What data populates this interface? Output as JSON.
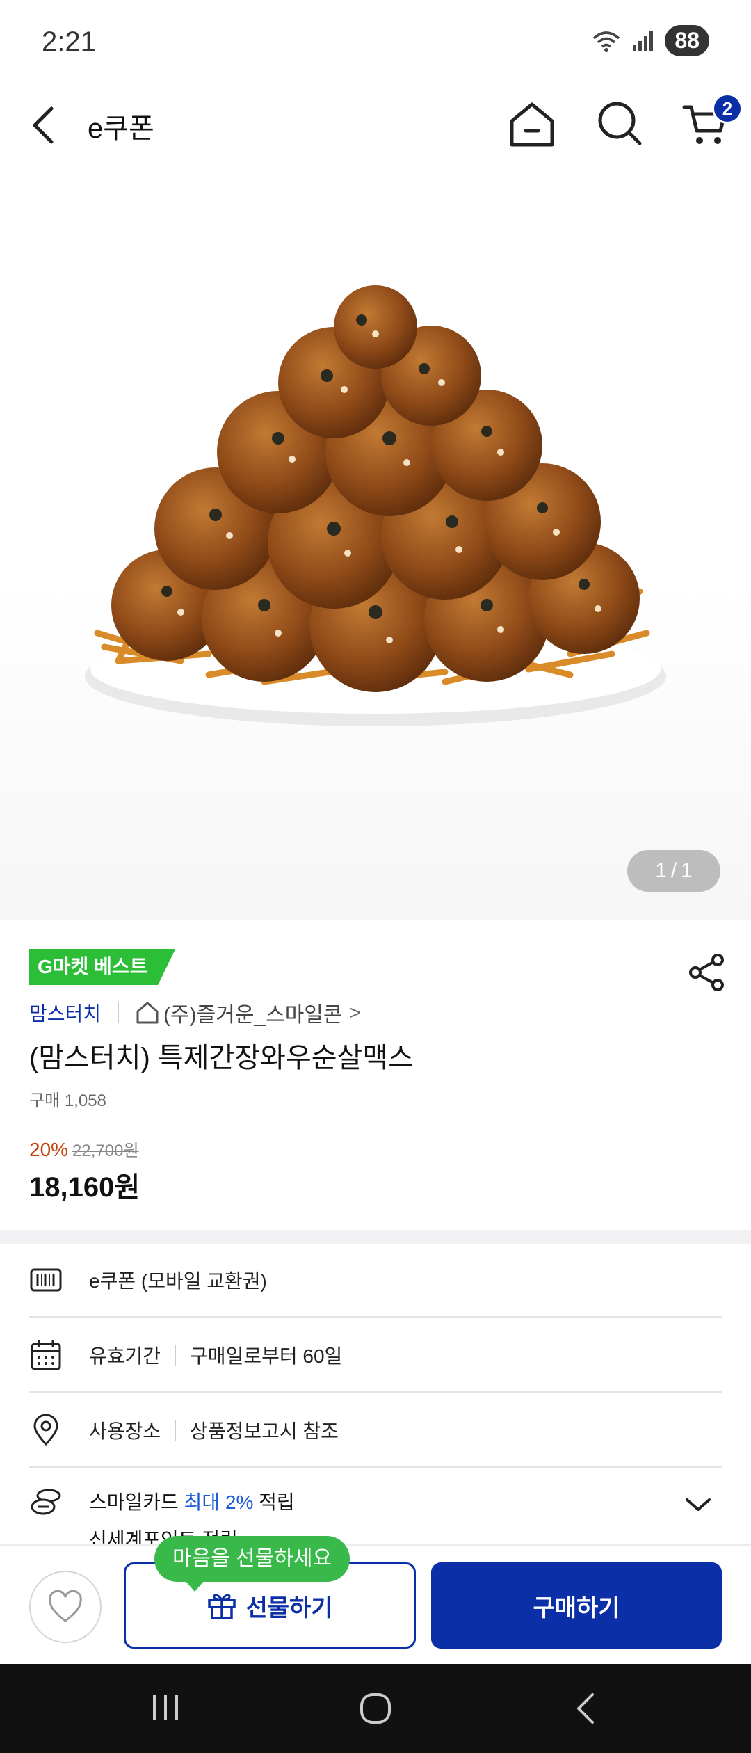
{
  "status_bar": {
    "time": "2:21",
    "battery": "88"
  },
  "header": {
    "title": "e쿠폰",
    "cart_count": "2"
  },
  "image": {
    "counter_current": "1",
    "counter_sep": "/",
    "counter_total": "1"
  },
  "product": {
    "badge": "G마켓 베스트",
    "brand": "맘스터치",
    "shop": "(주)즐거운_스마일콘",
    "shop_chevron": ">",
    "title": "(맘스터치) 특제간장와우순살맥스",
    "purchase_count": "구매 1,058",
    "discount": "20%",
    "original_price": "22,700원",
    "sale_price": "18,160원"
  },
  "details": {
    "type": "e쿠폰 (모바일 교환권)",
    "validity_label": "유효기간",
    "validity_value": "구매일로부터 60일",
    "location_label": "사용장소",
    "location_value": "상품정보고시 참조",
    "card_prefix": "스마일카드 ",
    "card_highlight": "최대 2%",
    "card_suffix": " 적립",
    "card_line2": "신세계포인트 적립"
  },
  "bottom_bar": {
    "tooltip": "마음을 선물하세요",
    "gift_label": "선물하기",
    "buy_label": "구매하기"
  },
  "colors": {
    "brand_blue": "#0a2fa6",
    "best_green": "#2dbe37",
    "discount_orange": "#c2410c"
  }
}
